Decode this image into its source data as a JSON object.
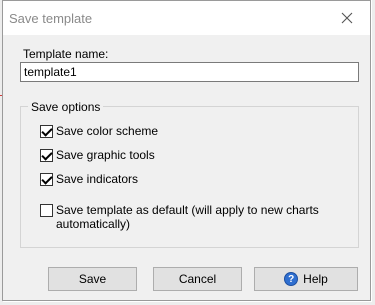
{
  "dialog": {
    "title": "Save template"
  },
  "template_name": {
    "label": "Template name:",
    "value": "template1"
  },
  "save_options": {
    "legend": "Save options",
    "items": [
      {
        "label": "Save color scheme",
        "checked": true
      },
      {
        "label": "Save graphic tools",
        "checked": true
      },
      {
        "label": "Save indicators",
        "checked": true
      },
      {
        "label": "Save template as default (will apply to new charts automatically)",
        "checked": false
      }
    ]
  },
  "buttons": {
    "save": "Save",
    "cancel": "Cancel",
    "help": "Help"
  },
  "icons": {
    "close": "close-icon",
    "help": "help-icon"
  },
  "colors": {
    "help_icon": "#2f6fd0",
    "title_text": "#8a8a8a"
  }
}
